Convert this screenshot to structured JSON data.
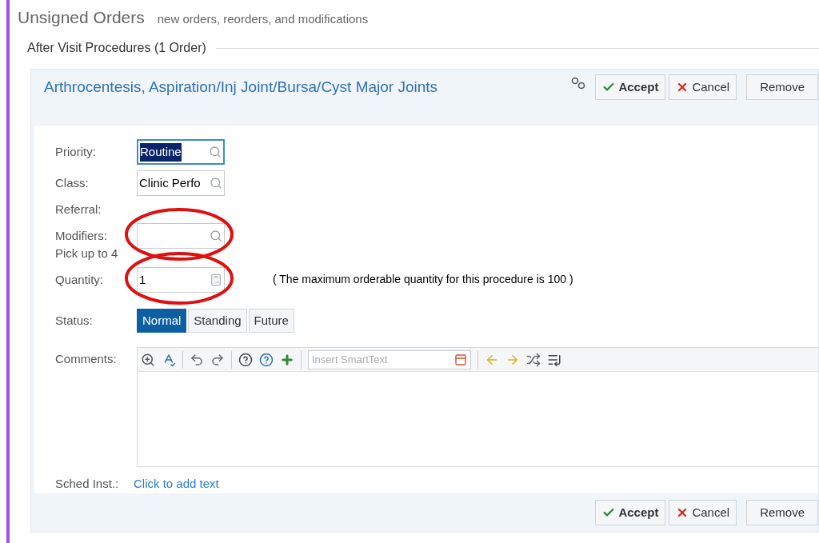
{
  "header": {
    "title": "Unsigned Orders",
    "subtitle": "new orders, reorders, and modifications"
  },
  "section": {
    "title": "After Visit Procedures (1 Order)"
  },
  "order": {
    "title": "Arthrocentesis, Aspiration/Inj Joint/Bursa/Cyst Major Joints",
    "header_buttons": [
      {
        "kind": "accept",
        "label": "Accept"
      },
      {
        "kind": "cancel",
        "label": "Cancel"
      },
      {
        "kind": "plain",
        "label": "Remove"
      }
    ],
    "fields": [
      {
        "label": "Priority:",
        "kind": "search",
        "value": "Routine",
        "focused": true,
        "annotated": false
      },
      {
        "label": "Class:",
        "kind": "search",
        "value": "Clinic Perfo",
        "focused": false,
        "annotated": false
      },
      {
        "label": "Referral:",
        "kind": "none"
      },
      {
        "label": "Modifiers:",
        "kind": "search",
        "focused": false,
        "annotated": true,
        "hint": "Pick up to 4"
      },
      {
        "label": "Quantity:",
        "kind": "calculator",
        "value": "1",
        "focused": false,
        "annotated": true,
        "note": "( The maximum orderable quantity for this procedure is 100 )"
      }
    ],
    "status": {
      "label": "Status:",
      "options": [
        {
          "label": "Normal",
          "selected": true
        },
        {
          "label": "Standing",
          "selected": false
        },
        {
          "label": "Future",
          "selected": false
        }
      ]
    },
    "comments": {
      "label": "Comments:",
      "smarttext_placeholder": "Insert SmartText"
    },
    "sched": {
      "label": "Sched Inst.:",
      "link": "Click to add text"
    },
    "footer_buttons": [
      {
        "kind": "accept",
        "label": "Accept"
      },
      {
        "kind": "cancel",
        "label": "Cancel"
      },
      {
        "kind": "plain",
        "label": "Remove"
      }
    ]
  }
}
